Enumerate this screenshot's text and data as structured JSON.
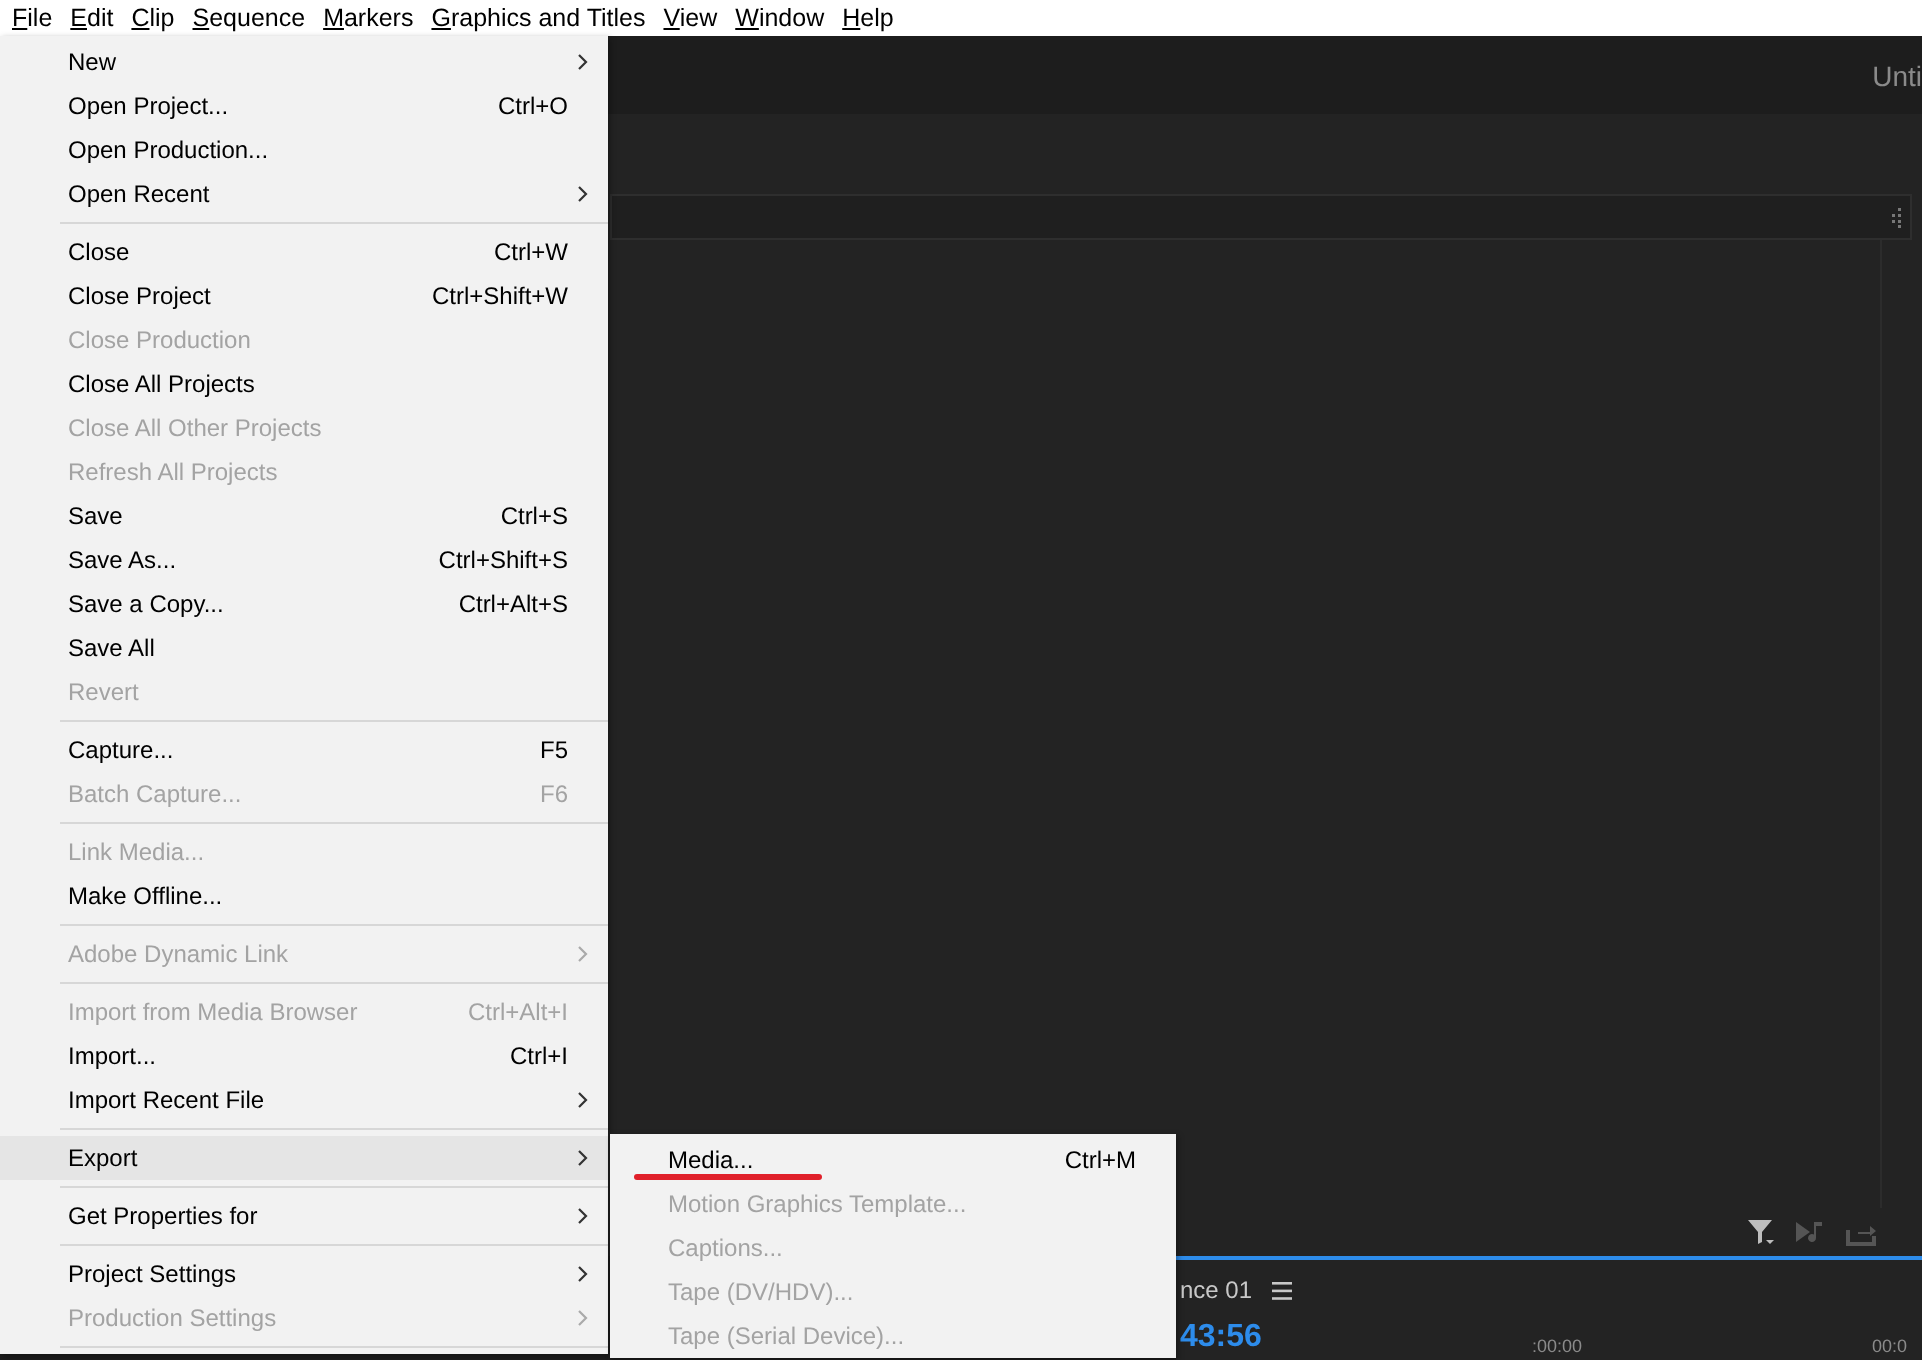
{
  "menu_bar": [
    "File",
    "Edit",
    "Clip",
    "Sequence",
    "Markers",
    "Graphics and Titles",
    "View",
    "Window",
    "Help"
  ],
  "workspace": {
    "header_title": "Unti",
    "timeline": {
      "tab_title": "nce 01",
      "timecode": "43:56",
      "ruler_labels": [
        ":00:00",
        "00:0"
      ]
    }
  },
  "file_menu": {
    "groups": [
      [
        {
          "label": "New",
          "has_submenu": true,
          "disabled": false,
          "selected": false
        },
        {
          "label": "Open Project...",
          "shortcut": "Ctrl+O",
          "has_submenu": false,
          "disabled": false,
          "selected": false
        },
        {
          "label": "Open Production...",
          "has_submenu": false,
          "disabled": false,
          "selected": false
        },
        {
          "label": "Open Recent",
          "has_submenu": true,
          "disabled": false,
          "selected": false
        }
      ],
      [
        {
          "label": "Close",
          "shortcut": "Ctrl+W",
          "has_submenu": false,
          "disabled": false,
          "selected": false
        },
        {
          "label": "Close Project",
          "shortcut": "Ctrl+Shift+W",
          "has_submenu": false,
          "disabled": false,
          "selected": false
        },
        {
          "label": "Close Production",
          "has_submenu": false,
          "disabled": true,
          "selected": false
        },
        {
          "label": "Close All Projects",
          "has_submenu": false,
          "disabled": false,
          "selected": false
        },
        {
          "label": "Close All Other Projects",
          "has_submenu": false,
          "disabled": true,
          "selected": false
        },
        {
          "label": "Refresh All Projects",
          "has_submenu": false,
          "disabled": true,
          "selected": false
        },
        {
          "label": "Save",
          "shortcut": "Ctrl+S",
          "has_submenu": false,
          "disabled": false,
          "selected": false
        },
        {
          "label": "Save As...",
          "shortcut": "Ctrl+Shift+S",
          "has_submenu": false,
          "disabled": false,
          "selected": false
        },
        {
          "label": "Save a Copy...",
          "shortcut": "Ctrl+Alt+S",
          "has_submenu": false,
          "disabled": false,
          "selected": false
        },
        {
          "label": "Save All",
          "has_submenu": false,
          "disabled": false,
          "selected": false
        },
        {
          "label": "Revert",
          "has_submenu": false,
          "disabled": true,
          "selected": false
        }
      ],
      [
        {
          "label": "Capture...",
          "shortcut": "F5",
          "has_submenu": false,
          "disabled": false,
          "selected": false
        },
        {
          "label": "Batch Capture...",
          "shortcut": "F6",
          "has_submenu": false,
          "disabled": true,
          "selected": false
        }
      ],
      [
        {
          "label": "Link Media...",
          "has_submenu": false,
          "disabled": true,
          "selected": false
        },
        {
          "label": "Make Offline...",
          "has_submenu": false,
          "disabled": false,
          "selected": false
        }
      ],
      [
        {
          "label": "Adobe Dynamic Link",
          "has_submenu": true,
          "disabled": true,
          "selected": false
        }
      ],
      [
        {
          "label": "Import from Media Browser",
          "shortcut": "Ctrl+Alt+I",
          "has_submenu": false,
          "disabled": true,
          "selected": false
        },
        {
          "label": "Import...",
          "shortcut": "Ctrl+I",
          "has_submenu": false,
          "disabled": false,
          "selected": false
        },
        {
          "label": "Import Recent File",
          "has_submenu": true,
          "disabled": false,
          "selected": false
        }
      ],
      [
        {
          "label": "Export",
          "has_submenu": true,
          "disabled": false,
          "selected": true
        }
      ],
      [
        {
          "label": "Get Properties for",
          "has_submenu": true,
          "disabled": false,
          "selected": false
        }
      ],
      [
        {
          "label": "Project Settings",
          "has_submenu": true,
          "disabled": false,
          "selected": false
        },
        {
          "label": "Production Settings",
          "has_submenu": true,
          "disabled": true,
          "selected": false
        }
      ]
    ]
  },
  "export_submenu": {
    "items": [
      {
        "label": "Media...",
        "shortcut": "Ctrl+M",
        "disabled": false,
        "underlined": true
      },
      {
        "label": "Motion Graphics Template...",
        "disabled": true,
        "underlined": false
      },
      {
        "label": "Captions...",
        "disabled": true,
        "underlined": false
      },
      {
        "label": "Tape (DV/HDV)...",
        "disabled": true,
        "underlined": false
      },
      {
        "label": "Tape (Serial Device)...",
        "disabled": true,
        "underlined": false
      }
    ]
  }
}
